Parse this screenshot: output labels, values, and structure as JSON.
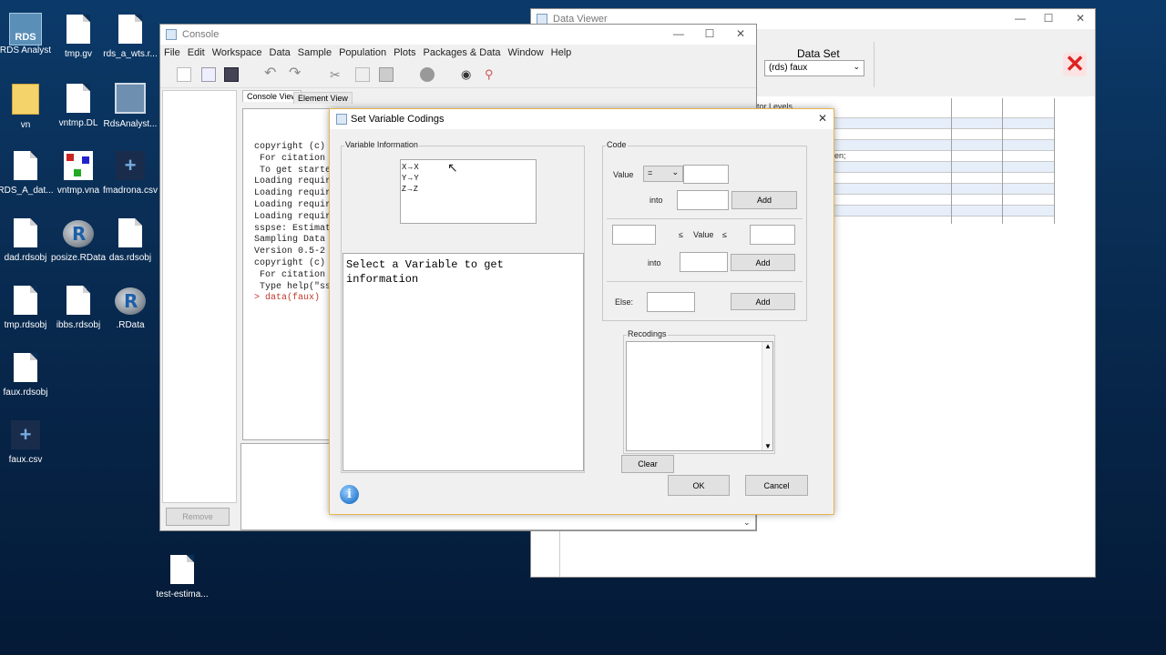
{
  "desktop": {
    "icons": [
      {
        "label": "RDS Analyst"
      },
      {
        "label": "tmp.gv"
      },
      {
        "label": "rds_a_wts.r..."
      },
      {
        "label": "vn"
      },
      {
        "label": "vntmp.DL"
      },
      {
        "label": "RdsAnalyst..."
      },
      {
        "label": "RDS_A_dat..."
      },
      {
        "label": "vntmp.vna"
      },
      {
        "label": "fmadrona.csv"
      },
      {
        "label": "dad.rdsobj"
      },
      {
        "label": "posize.RData"
      },
      {
        "label": "das.rdsobj"
      },
      {
        "label": "tmp.rdsobj"
      },
      {
        "label": "ibbs.rdsobj"
      },
      {
        "label": ".RData"
      },
      {
        "label": "faux.rdsobj"
      },
      {
        "label": "faux.csv"
      },
      {
        "label": "test-estima..."
      }
    ],
    "rds_icon_text": "RDS",
    "r_logo_letter": "R"
  },
  "data_viewer": {
    "title": "Data Viewer",
    "dataset_label": "Data Set",
    "dataset_value": "(rds) faux",
    "col_header_fragment": "tor Levels",
    "row_fragment": "en;"
  },
  "console": {
    "title": "Console",
    "menu": [
      "File",
      "Edit",
      "Workspace",
      "Data",
      "Sample",
      "Population",
      "Plots",
      "Packages & Data",
      "Window",
      "Help"
    ],
    "tabs": {
      "console_view": "Console View",
      "element_view": "Element View"
    },
    "remove_label": "Remove",
    "lines": [
      "copyright (c) 20",
      "",
      "",
      " For citation in",
      " To get started,",
      "",
      "Loading required",
      "Loading required",
      "Loading required",
      "Loading required",
      "sspse: Estimatin",
      "Sampling Data",
      "Version 0.5-2 cr",
      "copyright (c) 20",
      "",
      " For citation in",
      " Type help(\"ssps",
      "",
      "",
      "> data(faux)"
    ]
  },
  "dialog": {
    "title": "Set Variable Codings",
    "variable_info": {
      "label": "Variable Information",
      "items": [
        "X→X",
        "Y→Y",
        "Z→Z"
      ],
      "info_text": "Select a Variable to get information"
    },
    "code": {
      "label": "Code",
      "value_label": "Value",
      "operator": "=",
      "into_label": "into",
      "add_label": "Add",
      "leq": "≤",
      "range_value_label": "Value",
      "else_label": "Else:"
    },
    "recodings_label": "Recodings",
    "clear_label": "Clear",
    "ok_label": "OK",
    "cancel_label": "Cancel",
    "info_icon_glyph": "i"
  },
  "window_controls": {
    "minimize": "—",
    "maximize": "☐",
    "close": "✕"
  }
}
